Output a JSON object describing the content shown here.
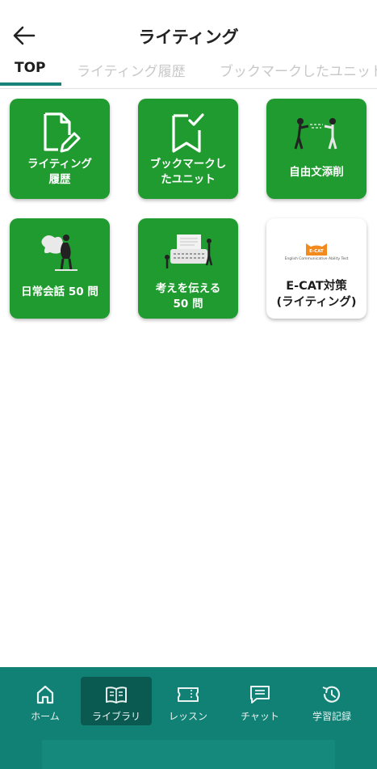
{
  "header": {
    "title": "ライティング"
  },
  "tabs": [
    {
      "label": "TOP",
      "active": true
    },
    {
      "label": "ライティング履歴",
      "active": false
    },
    {
      "label": "ブックマークしたユニット",
      "active": false
    }
  ],
  "tiles": [
    {
      "label": "ライティング\n履歴",
      "icon": "document-pencil-icon"
    },
    {
      "label": "ブックマークし\nたユニット",
      "icon": "bookmark-check-icon"
    },
    {
      "label": "自由文添削",
      "icon": "people-illustration-icon"
    },
    {
      "label": "日常会話 50 問",
      "icon": "person-thinking-illustration-icon"
    },
    {
      "label": "考えを伝える\n50 問",
      "icon": "typewriter-illustration-icon"
    },
    {
      "label": "E-CAT対策\n(ライティング)",
      "icon": "ecat-logo-icon",
      "logo_text": "E-CAT",
      "logo_subtext": "English Communicative Ability Test"
    }
  ],
  "bottom_nav": [
    {
      "label": "ホーム",
      "icon": "home-icon",
      "active": false
    },
    {
      "label": "ライブラリ",
      "icon": "book-icon",
      "active": true
    },
    {
      "label": "レッスン",
      "icon": "ticket-icon",
      "active": false
    },
    {
      "label": "チャット",
      "icon": "chat-icon",
      "active": false
    },
    {
      "label": "学習記録",
      "icon": "history-icon",
      "active": false
    }
  ],
  "colors": {
    "tile_green": "#1f9b2f",
    "accent_teal": "#17837a",
    "nav_bg": "#128175",
    "nav_active": "#0b5a52"
  }
}
